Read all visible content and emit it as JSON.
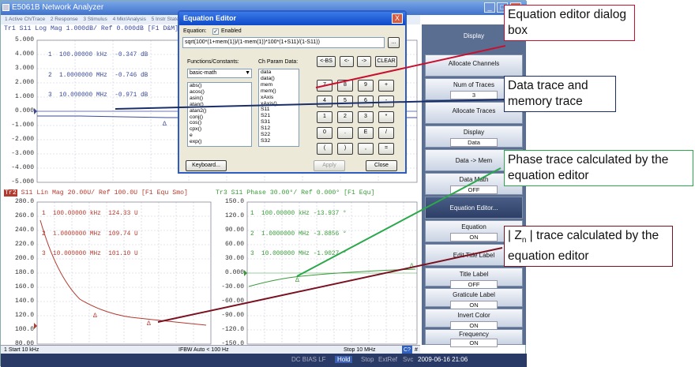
{
  "window": {
    "title": "E5061B Network Analyzer",
    "min": "_",
    "max": "□",
    "close": "✕"
  },
  "menu": [
    "1 Active Ch/Trace",
    "2 Response",
    "3 Stimulus",
    "4 Mkr/Analysis",
    "5 Instr State"
  ],
  "plot1": {
    "header": "Tr1 S11 Log Mag 1.000dB/ Ref 0.000dB [F1 D&M]",
    "yticks": [
      "5.000",
      "4.000",
      "3.000",
      "2.000",
      "1.000",
      "0.000",
      "-1.000",
      "-2.000",
      "-3.000",
      "-4.000",
      "-5.000"
    ],
    "markers": [
      "1  100.00000 kHz  -0.347 dB",
      "2  1.0000000 MHz  -0.746 dB",
      "3  10.000000 MHz  -0.971 dB"
    ]
  },
  "plot2": {
    "header_tag": "Tr2",
    "header": "S11 Lin Mag 20.00U/ Ref 100.0U [F1 Equ Smo]",
    "yticks": [
      "280.0",
      "260.0",
      "240.0",
      "220.0",
      "200.0",
      "180.0",
      "160.0",
      "140.0",
      "120.0",
      "100.0",
      "80.00"
    ],
    "markers": [
      "1  100.00000 kHz  124.33 U",
      "2  1.0000000 MHz  109.74 U",
      "3  10.000000 MHz  101.10 U"
    ]
  },
  "plot3": {
    "header": "Tr3 S11 Phase 30.00°/ Ref 0.000° [F1 Equ]",
    "yticks": [
      "150.0",
      "120.0",
      "90.00",
      "60.00",
      "30.00",
      "0.000",
      "-30.00",
      "-60.00",
      "-90.00",
      "-120.0",
      "-150.0"
    ],
    "markers": [
      "1  100.00000 kHz -13.937 °",
      "2  1.0000000 MHz -3.8856 °",
      "3  10.000000 MHz -1.9027 °"
    ]
  },
  "status": {
    "start": "1 Start 10 kHz",
    "ifbw": "IFBW Auto < 100 Hz",
    "stop": "Stop 10 MHz",
    "cal": "C?",
    "hash": "#"
  },
  "status2": {
    "dcbias": "DC BIAS LF",
    "hold": "Hold",
    "stop": "Stop",
    "extref": "ExtRef",
    "svc": "Svc",
    "datetime": "2009-06-16 21:06"
  },
  "softkeys": {
    "display": "Display",
    "allocate_channels": "Allocate Channels",
    "num_traces": "Num of Traces",
    "num_traces_val": "3",
    "allocate_traces": "Allocate Traces",
    "display_k": "Display",
    "display_val": "Data",
    "data_mem": "Data -> Mem",
    "data_math": "Data Math",
    "data_math_val": "OFF",
    "equation_editor": "Equation Editor...",
    "equation": "Equation",
    "equation_val": "ON",
    "edit_title": "Edit Title Label",
    "title_label": "Title Label",
    "title_label_val": "OFF",
    "graticule": "Graticule Label",
    "graticule_val": "ON",
    "invert": "Invert Color",
    "invert_val": "ON",
    "frequency": "Frequency",
    "frequency_val": "ON"
  },
  "dialog": {
    "title": "Equation Editor",
    "close": "X",
    "equation_label": "Equation:",
    "enabled_label": "Enabled",
    "equation_value": "sqrt(100*(1+mem(1))/(1-mem(1))*100*(1+S11)/(1-S11))",
    "browse": "...",
    "functions_label": "Functions/Constants:",
    "functions_select": "basic-math",
    "ch_param_label": "Ch Param Data:",
    "functions": [
      "abs()",
      "acos()",
      "asin()",
      "atan()",
      "atan2()",
      "conj()",
      "cos()",
      "cpx()",
      "e",
      "exp()"
    ],
    "params": [
      "data",
      "data()",
      "mem",
      "mem()",
      "xAxis",
      "xAxis()",
      "S11",
      "S21",
      "S31",
      "S12",
      "S22",
      "S32"
    ],
    "bs": "<-BS",
    "left": "<-",
    "right": "->",
    "clear": "CLEAR",
    "keypad": [
      "7",
      "8",
      "9",
      "+",
      "4",
      "5",
      "6",
      "-",
      "1",
      "2",
      "3",
      "*",
      "0",
      ".",
      "E",
      "/",
      "(",
      ")",
      ",",
      "="
    ],
    "keyboard": "Keyboard...",
    "apply": "Apply",
    "close_btn": "Close"
  },
  "callouts": {
    "c1": "Equation editor dialog box",
    "c2": "Data trace and memory trace",
    "c3": "Phase trace calculated by the equation editor",
    "c4_prefix": "| Z",
    "c4_sub": "n",
    "c4_suffix": " | trace calculated by the equation editor"
  },
  "colors": {
    "trace1": "#3a4a9a",
    "trace2": "#b23a2e",
    "trace3": "#3a9a3a",
    "callout_red": "#c8102e",
    "callout_navy": "#1a2f6a",
    "callout_green": "#2aa84a",
    "callout_maroon": "#7a1020"
  }
}
